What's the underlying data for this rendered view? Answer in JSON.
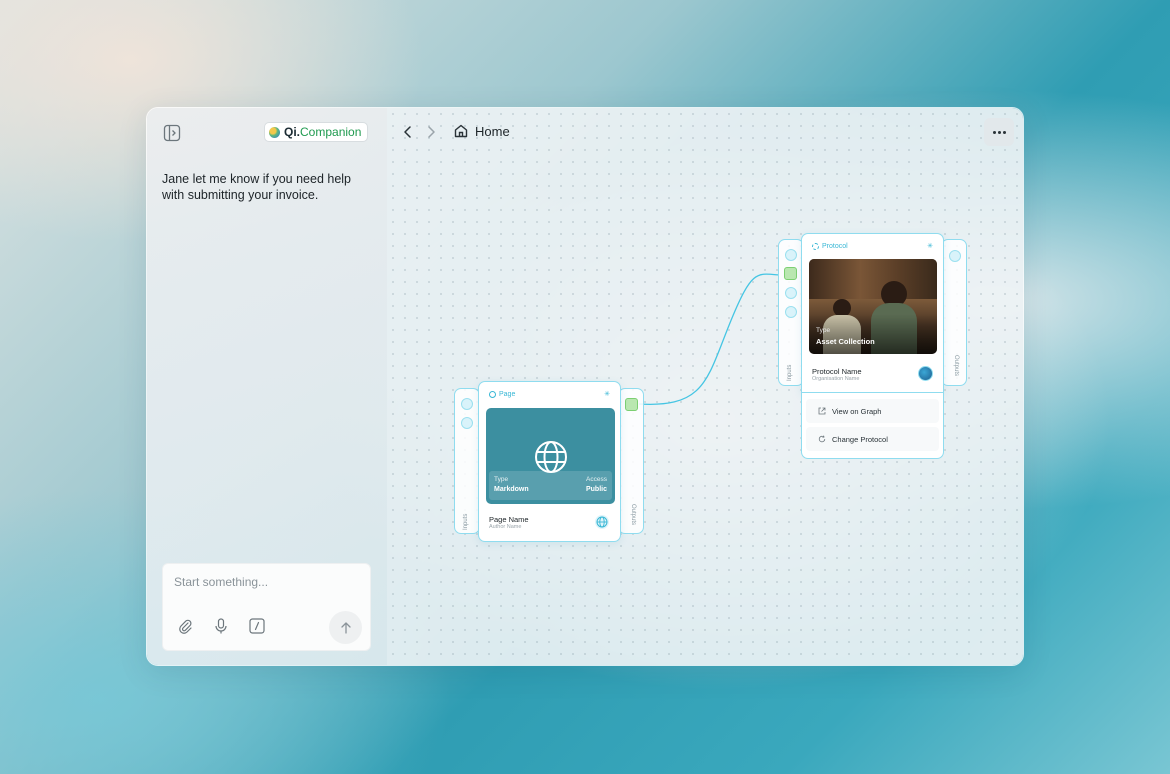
{
  "sidebar": {
    "brand": {
      "prefix": "Qi.",
      "name": "Companion"
    },
    "message": "Jane let me know if you need help with submitting your invoice.",
    "composer": {
      "placeholder": "Start something...",
      "tools": [
        "paperclip-icon",
        "microphone-icon",
        "slash-command-icon"
      ],
      "send_icon": "arrow-up-icon"
    }
  },
  "header": {
    "breadcrumb": "Home",
    "more_icon": "ellipsis-icon"
  },
  "nodes": {
    "page": {
      "header": "Page",
      "type_label": "Type",
      "type_value": "Markdown",
      "access_label": "Access",
      "access_value": "Public",
      "name": "Page Name",
      "author": "Author Name",
      "inputs_label": "Inputs",
      "outputs_label": "Outputs"
    },
    "protocol": {
      "header": "Protocol",
      "type_label": "Type",
      "type_value": "Asset Collection",
      "name": "Protocol Name",
      "organisation": "Organisation Name",
      "inputs_label": "Inputs",
      "outputs_label": "Outputs",
      "menu": [
        "View on Graph",
        "Change Protocol"
      ]
    }
  },
  "colors": {
    "accent": "#38b7d5",
    "brand_green": "#1f9a4f",
    "port_green": "#b9e7b0"
  }
}
